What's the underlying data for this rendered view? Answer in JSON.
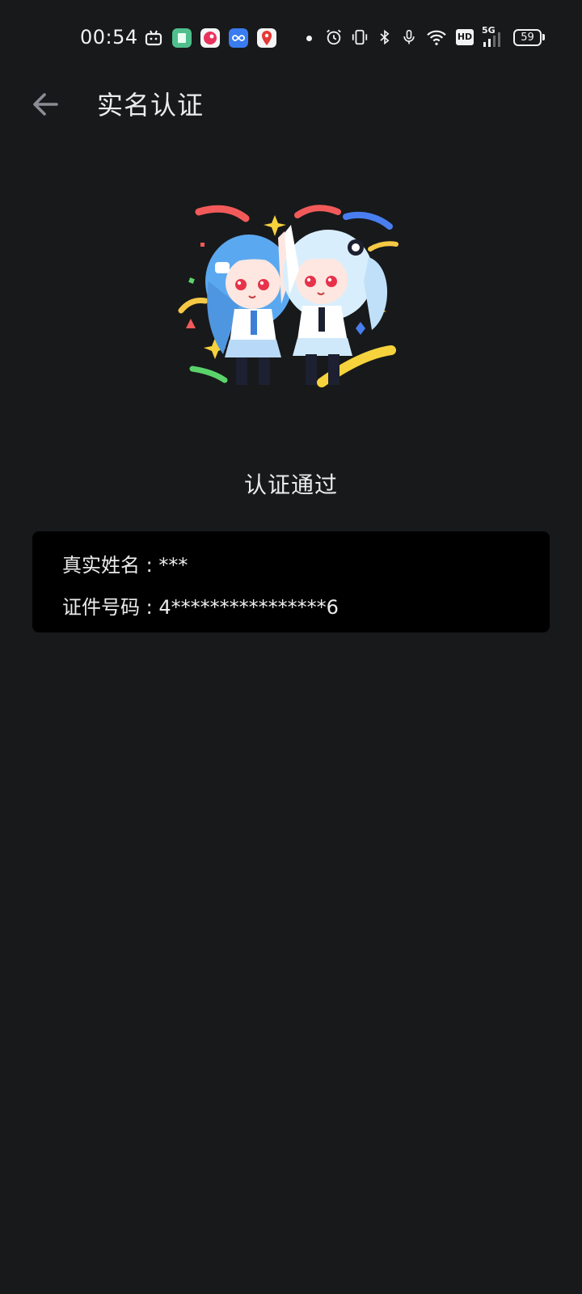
{
  "status_bar": {
    "time": "00:54",
    "notification_icons": [
      "bilibili-tv-icon",
      "green-book-app-icon",
      "red-app-icon",
      "blue-infinity-app-icon",
      "red-map-pin-app-icon"
    ],
    "system_icons": [
      "alarm-icon",
      "vibrate-icon",
      "bluetooth-icon",
      "microphone-icon",
      "wifi-icon",
      "hd-icon",
      "5g-signal-icon"
    ],
    "network_label": "5G",
    "hd_label": "HD",
    "battery": "59"
  },
  "app_bar": {
    "back_icon": "arrow-left-icon",
    "title": "实名认证"
  },
  "result": {
    "status_text": "认证通过",
    "name_row": "真实姓名 : ***",
    "id_row": "证件号码 : 4****************6"
  },
  "colors": {
    "background": "#18191b",
    "card": "#000000",
    "text": "#ececec",
    "back_arrow": "#8a8d93"
  }
}
